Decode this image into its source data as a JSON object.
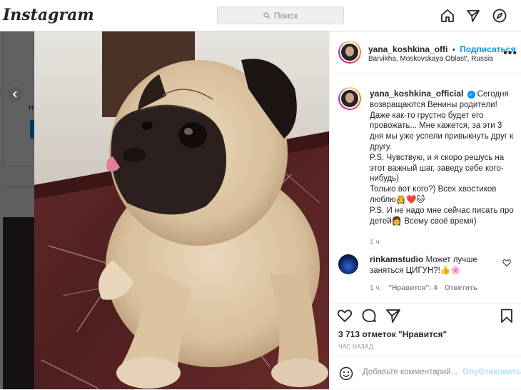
{
  "app": {
    "logo_text": "Instagram"
  },
  "search": {
    "placeholder": "Поиск",
    "icon": "search-icon"
  },
  "nav": {
    "icons": [
      "home-icon",
      "direct-icon",
      "explore-icon"
    ]
  },
  "feed": {
    "partial_text": "Н"
  },
  "post": {
    "author": "yana_koshkina_offi",
    "follow_label": "Подписаться",
    "separator": "•",
    "location": "Barvikha, Moskovskaya Oblast', Russia",
    "more_label": "•••",
    "caption_author": "yana_koshkina_official",
    "verified_mark": "✓",
    "caption_text": "Сегодня возвращаются Венины родители! Даже как-то грустно будет его провожать... Мне кажется, за эти 3 дня мы уже успели привыкнуть друг к другу.\nP.S. Чувствую, и я скоро решусь на этот важный шаг, заведу себе кого-нибудь)\nТолько вот кого?) Всех хвостиков люблю👸❤️🐱\nP.S. И не надо мне сейчас писать про детей👩 Всему своё время)",
    "caption_time": "1 ч.",
    "comment": {
      "author": "rinkamstudio",
      "text": "Может лучше заняться ЦИГУН?!👍🌸",
      "time": "1 ч.",
      "likes": "\"Нравится\": 4",
      "reply": "Ответить"
    },
    "likes_count": "3 713 отметок \"Нравится\"",
    "time_ago": "ЧАС НАЗАД",
    "add_comment_placeholder": "Добавьте комментарий...",
    "publish_label": "Опубликовать"
  },
  "colors": {
    "accent": "#0095f6",
    "publish_disabled": "#b2dffc",
    "text": "#262626",
    "muted": "#8e8e8e"
  }
}
